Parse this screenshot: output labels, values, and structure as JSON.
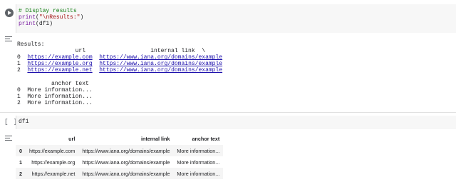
{
  "cell1": {
    "code_lines": [
      {
        "type": "comment",
        "text": "# Display results"
      },
      {
        "type": "call",
        "fn": "print",
        "arg": "\"\\nResults:\""
      },
      {
        "type": "call",
        "fn": "print",
        "arg": "df1"
      }
    ],
    "output": {
      "heading": "Results:",
      "block1_header": "                 url                   internal link  \\",
      "block1_rows": [
        {
          "idx": "0",
          "url": "https://example.com",
          "link": "https://www.iana.org/domains/example"
        },
        {
          "idx": "1",
          "url": "https://example.org",
          "link": "https://www.iana.org/domains/example"
        },
        {
          "idx": "2",
          "url": "https://example.net",
          "link": "https://www.iana.org/domains/example"
        }
      ],
      "block2_header": "          anchor text",
      "block2_rows": [
        {
          "idx": "0",
          "text": "More information..."
        },
        {
          "idx": "1",
          "text": "More information..."
        },
        {
          "idx": "2",
          "text": "More information..."
        }
      ]
    }
  },
  "cell2": {
    "exec_count": "[ ]",
    "code": "df1",
    "table": {
      "columns": [
        "",
        "url",
        "internal link",
        "anchor text"
      ],
      "rows": [
        [
          "0",
          "https://example.com",
          "https://www.iana.org/domains/example",
          "More information..."
        ],
        [
          "1",
          "https://example.org",
          "https://www.iana.org/domains/example",
          "More information..."
        ],
        [
          "2",
          "https://example.net",
          "https://www.iana.org/domains/example",
          "More information..."
        ]
      ]
    }
  }
}
